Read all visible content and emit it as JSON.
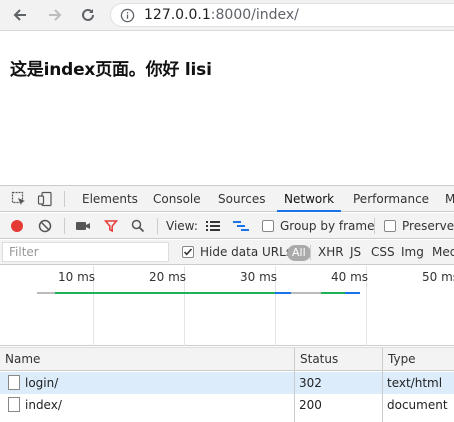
{
  "browser": {
    "url_host": "127.0.0.1",
    "url_path": ":8000/index/"
  },
  "page": {
    "heading": "这是index页面。你好 lisi"
  },
  "devtools": {
    "tabs": [
      {
        "label": "Elements",
        "active": false
      },
      {
        "label": "Console",
        "active": false
      },
      {
        "label": "Sources",
        "active": false
      },
      {
        "label": "Network",
        "active": true
      },
      {
        "label": "Performance",
        "active": false
      },
      {
        "label": "M",
        "active": false
      }
    ],
    "controls": {
      "view_label": "View:",
      "group_by_frame": "Group by frame",
      "preserve_log": "Preserve lo"
    },
    "filter": {
      "placeholder": "Filter",
      "hide_data_urls": "Hide data URLs",
      "types": [
        "All",
        "XHR",
        "JS",
        "CSS",
        "Img",
        "Med"
      ]
    },
    "overview": {
      "ticks": [
        "10 ms",
        "20 ms",
        "30 ms",
        "40 ms",
        "50 ms"
      ]
    },
    "table": {
      "columns": [
        "Name",
        "Status",
        "Type"
      ],
      "rows": [
        {
          "name": "login/",
          "status": "302",
          "type": "text/html"
        },
        {
          "name": "index/",
          "status": "200",
          "type": "document"
        }
      ]
    }
  },
  "colors": {
    "record_red": "#e53935",
    "active_blue": "#1a73e8",
    "selected_row": "#dcecfb",
    "waterfall_green": "#1fb25a",
    "waterfall_blue": "#1a73e8"
  }
}
